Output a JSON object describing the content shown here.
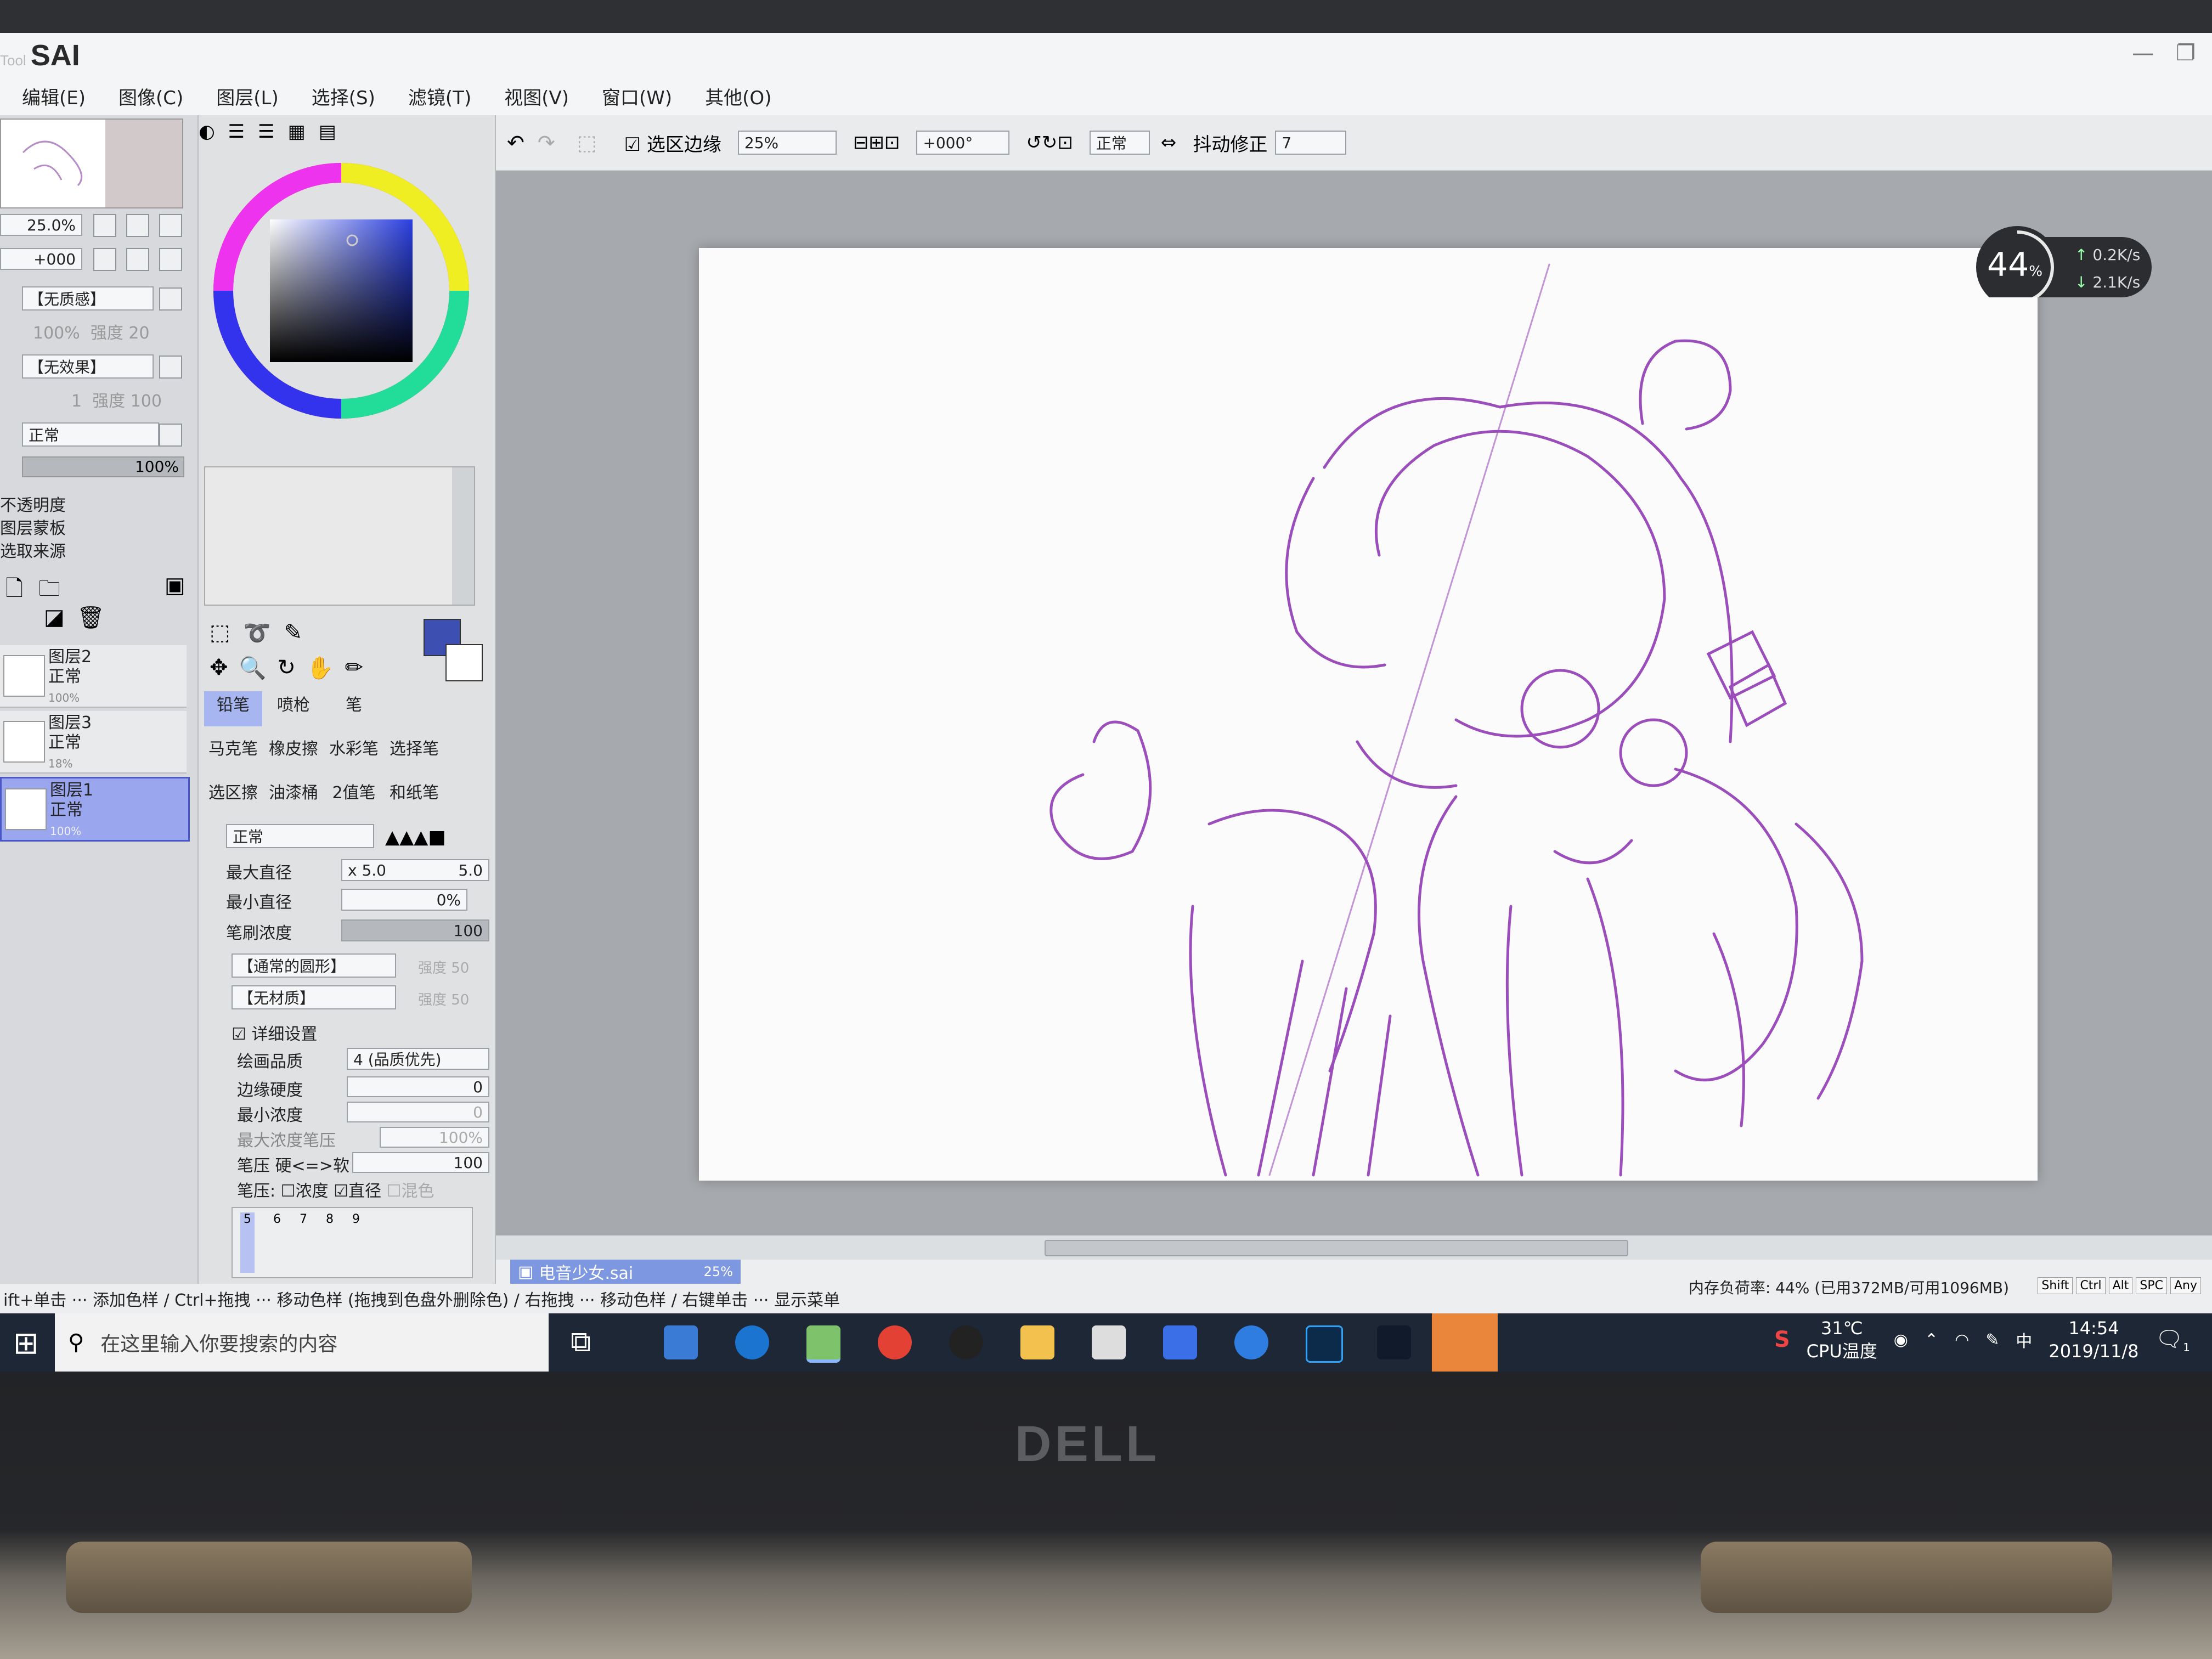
{
  "app": {
    "logo": "SAI",
    "logo_prefix": "Tool"
  },
  "menu": [
    "编辑(E)",
    "图像(C)",
    "图层(L)",
    "选择(S)",
    "滤镜(T)",
    "视图(V)",
    "窗口(W)",
    "其他(O)"
  ],
  "navigator": {
    "zoom": "25.0%",
    "rotation": "+000"
  },
  "brush_texture": {
    "texture": "【无质感】",
    "texture_values": [
      "100%",
      "强度 20"
    ],
    "effect": "【无效果】",
    "effect_values": [
      "1",
      "强度 100"
    ]
  },
  "layer_props": {
    "mode": "正常",
    "opacity": "100%",
    "checks": [
      "不透明度",
      "图层蒙板",
      "选取来源"
    ]
  },
  "layers": [
    {
      "name": "图层2",
      "mode": "正常",
      "opacity": "100%"
    },
    {
      "name": "图层3",
      "mode": "正常",
      "opacity": "18%"
    },
    {
      "name": "图层1",
      "mode": "正常",
      "opacity": "100%",
      "selected": true
    }
  ],
  "tools_row1": [
    "铅笔",
    "喷枪",
    "笔"
  ],
  "tools_row2": [
    "马克笔",
    "橡皮擦",
    "水彩笔",
    "选择笔"
  ],
  "tools_row3": [
    "选区擦",
    "油漆桶",
    "2值笔",
    "和纸笔"
  ],
  "brush": {
    "mode": "正常",
    "max_diameter_label": "最大直径",
    "max_diameter_mult": "x 5.0",
    "max_diameter_value": "5.0",
    "min_diameter_label": "最小直径",
    "min_diameter_value": "0%",
    "density_label": "笔刷浓度",
    "density_value": "100",
    "shape": "【通常的圆形】",
    "shape_strength": "强度 50",
    "material": "【无材质】",
    "material_strength": "强度 50",
    "detail_label": "详细设置",
    "quality_label": "绘画品质",
    "quality_value": "4 (品质优先)",
    "edge_label": "边缘硬度",
    "edge_value": "0",
    "min_density_label": "最小浓度",
    "min_density_value": "0",
    "max_density_pressure_label": "最大浓度笔压",
    "max_density_pressure_value": "100%",
    "pressure_label": "笔压 硬<=>软",
    "pressure_value": "100",
    "pressure_opts_label": "笔压:",
    "pressure_opts": [
      "浓度",
      "直径",
      "混色"
    ],
    "size_presets": [
      "5",
      "6",
      "7",
      "8",
      "9"
    ]
  },
  "toolbar": {
    "select_edge": "选区边缘",
    "zoom": "25%",
    "rotate": "+000°",
    "mode": "正常",
    "stabilizer_label": "抖动修正",
    "stabilizer_value": "7"
  },
  "document": {
    "tab_name": "电音少女.sai",
    "tab_zoom": "25%"
  },
  "overlay": {
    "percent": "44",
    "up": "0.2K/s",
    "down": "2.1K/s"
  },
  "status": {
    "hint": "ift+单击 ··· 添加色样 / Ctrl+拖拽 ··· 移动色样 (拖拽到色盘外删除色) / 右拖拽 ··· 移动色样 / 右键单击 ··· 显示菜单",
    "memory": "内存负荷率: 44% (已用372MB/可用1096MB)",
    "modkeys": [
      "Shift",
      "Ctrl",
      "Alt",
      "SPC",
      "Any"
    ]
  },
  "taskbar": {
    "search_placeholder": "在这里输入你要搜索的内容",
    "temp": "31℃",
    "temp_label": "CPU温度",
    "ime": "中",
    "time": "14:54",
    "date": "2019/11/8",
    "notification_count": "1"
  },
  "hardware": {
    "brand": "DELL"
  },
  "colors": {
    "accent": "#4957c9",
    "stroke": "#8a2fb0",
    "current_color": "#3d4fb0"
  }
}
